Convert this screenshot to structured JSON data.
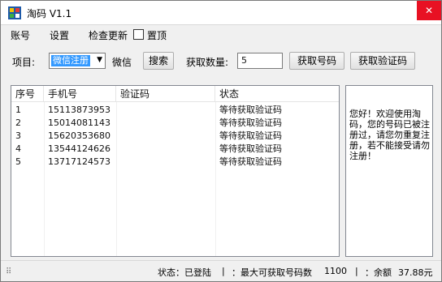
{
  "window": {
    "title": "淘码 V1.1",
    "close_glyph": "✕"
  },
  "menu": {
    "account": "账号",
    "settings": "设置",
    "check_update": "检查更新",
    "topmost": "置顶"
  },
  "toolbar": {
    "project_label": "项目:",
    "project_value": "微信注册",
    "project_name": "微信",
    "search_button": "搜索",
    "count_label": "获取数量:",
    "count_value": "5",
    "get_number_button": "获取号码",
    "get_code_button": "获取验证码"
  },
  "table": {
    "headers": [
      "序号",
      "手机号",
      "验证码",
      "状态"
    ],
    "rows": [
      [
        "1",
        "15113873953",
        "",
        "等待获取验证码"
      ],
      [
        "2",
        "15014081143",
        "",
        "等待获取验证码"
      ],
      [
        "3",
        "15620353680",
        "",
        "等待获取验证码"
      ],
      [
        "4",
        "13544124626",
        "",
        "等待获取验证码"
      ],
      [
        "5",
        "13717124573",
        "",
        "等待获取验证码"
      ]
    ]
  },
  "side_panel": {
    "text": "您好！欢迎使用淘码，您的号码已被注册过，请您勿重复注册，若不能接受请勿注册！"
  },
  "status": {
    "login": "状态：已登陆",
    "sep1": "|",
    "max_label": "：最大可获取号码数",
    "max_value": "1100",
    "sep2": "|",
    "balance_label": "：余额",
    "balance_value": "37.88元"
  },
  "colors": {
    "selection": "#3399ff",
    "close": "#e81123"
  }
}
